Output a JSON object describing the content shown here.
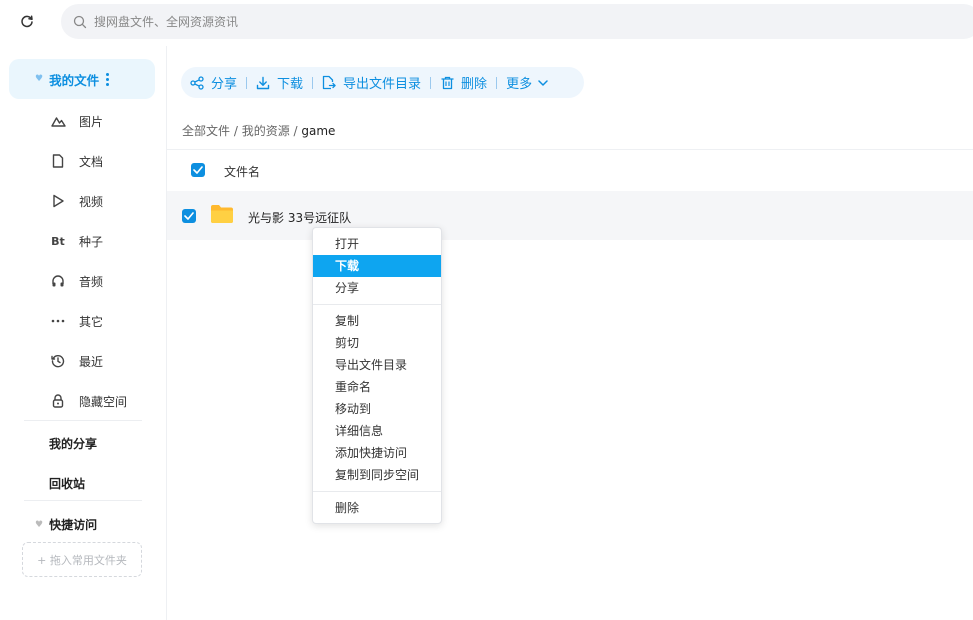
{
  "search": {
    "placeholder": "搜网盘文件、全网资源资讯"
  },
  "sidebar": {
    "my_files": "我的文件",
    "items": [
      {
        "label": "图片",
        "icon": "image-icon"
      },
      {
        "label": "文档",
        "icon": "document-icon"
      },
      {
        "label": "视频",
        "icon": "video-icon"
      },
      {
        "label": "种子",
        "icon": "bt-icon",
        "glyph": "Bt"
      },
      {
        "label": "音频",
        "icon": "headphones-icon"
      },
      {
        "label": "其它",
        "icon": "more-icon"
      },
      {
        "label": "最近",
        "icon": "history-icon"
      },
      {
        "label": "隐藏空间",
        "icon": "lock-icon"
      }
    ],
    "my_share": "我的分享",
    "recycle": "回收站",
    "quick_access": "快捷访问",
    "drop_hint": "+ 拖入常用文件夹"
  },
  "toolbar": {
    "share": "分享",
    "download": "下载",
    "export": "导出文件目录",
    "delete": "删除",
    "more": "更多"
  },
  "breadcrumb": {
    "all": "全部文件",
    "sep": " / ",
    "res": "我的资源",
    "current": "game"
  },
  "table": {
    "header": "文件名",
    "rows": [
      {
        "name": "光与影 33号远征队"
      }
    ]
  },
  "context_menu": {
    "items": [
      "打开",
      "下载",
      "分享",
      "复制",
      "剪切",
      "导出文件目录",
      "重命名",
      "移动到",
      "详细信息",
      "添加快捷访问",
      "复制到同步空间",
      "删除"
    ],
    "highlighted": "下载"
  },
  "colors": {
    "accent": "#0d8fe0",
    "highlight": "#0ea5f0",
    "folder": "#ffc53d"
  }
}
